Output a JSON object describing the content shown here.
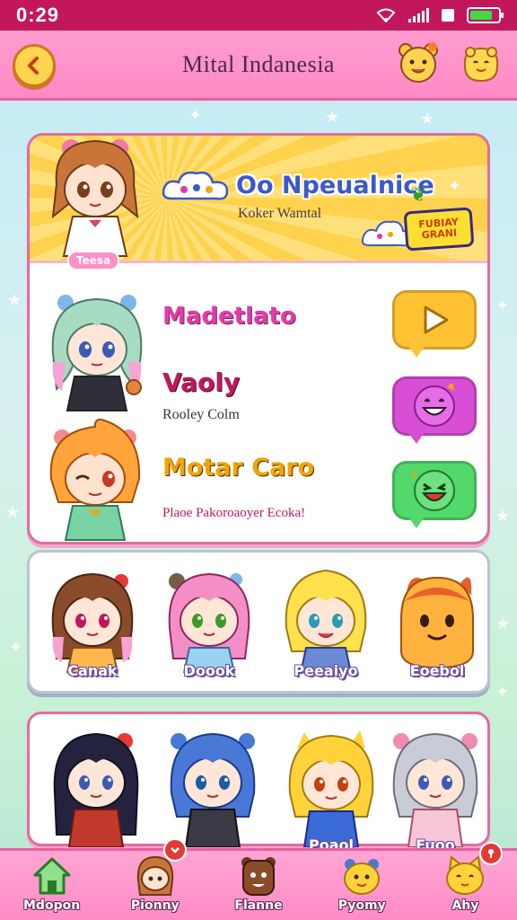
{
  "status_bar": {
    "time": "0:29"
  },
  "header": {
    "title": "Mital Indanesia"
  },
  "banner": {
    "title": "Oo Npeualnice",
    "subtitle": "Koker Wamtal",
    "badge": "Teesa",
    "promo_line1": "FUBIAY",
    "promo_line2": "GRANI"
  },
  "menu": {
    "items": [
      {
        "title": "Madetlato",
        "subtitle": "",
        "title_color": "#e53aa8"
      },
      {
        "title": "Vaoly",
        "subtitle": "Rooley Colm",
        "title_color": "#c2185b"
      },
      {
        "title": "Motar Caro",
        "subtitle": "Plaoe Pakoroaoyer Ecoka!",
        "title_color": "#f2a400"
      }
    ]
  },
  "strip_a": {
    "characters": [
      {
        "label": "Canak"
      },
      {
        "label": "Doook"
      },
      {
        "label": "Peeaiyo"
      },
      {
        "label": "Eoebol"
      }
    ]
  },
  "strip_b": {
    "characters": [
      {
        "label": ""
      },
      {
        "label": ""
      },
      {
        "label": "Poaol"
      },
      {
        "label": "Fuoo"
      }
    ]
  },
  "bottom_nav": {
    "items": [
      {
        "label": "Mdopon",
        "icon": "home-icon"
      },
      {
        "label": "Pionny",
        "icon": "character-icon",
        "badge": ""
      },
      {
        "label": "Flanne",
        "icon": "bear-icon"
      },
      {
        "label": "Pyomy",
        "icon": "chick-icon"
      },
      {
        "label": "Ahy",
        "icon": "cat-icon",
        "badge": ""
      }
    ]
  },
  "colors": {
    "status_bar": "#c2185b",
    "header": "#ff8ac6",
    "accent_border": "#e46aa0",
    "play_button": "#ffc233",
    "chat_purple": "#d84fd6",
    "chat_green": "#52d86b"
  }
}
